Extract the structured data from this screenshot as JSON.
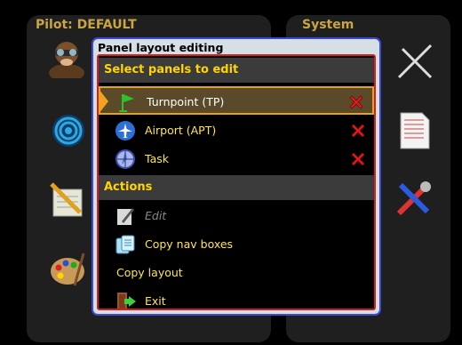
{
  "background": {
    "left_title": "Pilot: DEFAULT",
    "right_title": "System",
    "left_icons": [
      "pilot-icon",
      "target-icon",
      "notepad-icon",
      "palette-icon"
    ],
    "right_icons": [
      "glider-icon",
      "document-icon",
      "tools-icon"
    ]
  },
  "dialog": {
    "title": "Panel layout editing",
    "section_panels": "Select panels to edit",
    "panels": [
      {
        "label": "Turnpoint (TP)",
        "icon": "flag-icon",
        "selected": true
      },
      {
        "label": "Airport (APT)",
        "icon": "airport-icon",
        "selected": false
      },
      {
        "label": "Task",
        "icon": "task-icon",
        "selected": false
      }
    ],
    "section_actions": "Actions",
    "actions": [
      {
        "label": "Edit",
        "icon": "edit-icon",
        "disabled": true
      },
      {
        "label": "Copy nav boxes",
        "icon": "copy-icon",
        "disabled": false
      },
      {
        "label": "Copy layout",
        "icon": "",
        "disabled": false
      },
      {
        "label": "Exit",
        "icon": "exit-icon",
        "disabled": false
      }
    ]
  },
  "colors": {
    "accent": "#ffd400",
    "dialog_border": "#3a49d8",
    "inner_border": "#d21f1f",
    "selection": "#e6a21e"
  }
}
